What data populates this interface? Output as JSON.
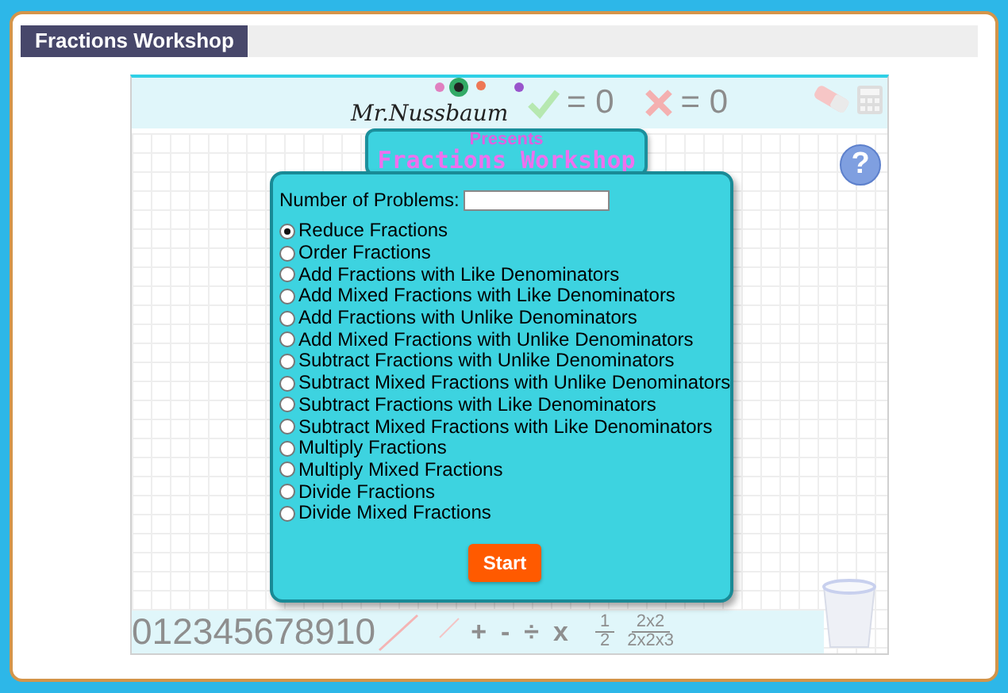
{
  "header": {
    "title": "Fractions Workshop"
  },
  "scoreboard": [
    {
      "kind": "correct",
      "text": "= 0"
    },
    {
      "kind": "wrong",
      "text": "= 0"
    }
  ],
  "logo": {
    "signature": "Mr.Nussbaum",
    "presents": "Presents",
    "title": "Fractions Workshop"
  },
  "help": {
    "text": "?"
  },
  "form": {
    "label": "Number of Problems:",
    "options": [
      {
        "label": "Reduce Fractions",
        "selected": true
      },
      {
        "label": "Order Fractions",
        "selected": false
      },
      {
        "label": "Add Fractions with Like Denominators",
        "selected": false
      },
      {
        "label": "Add Mixed Fractions with Like Denominators",
        "selected": false
      },
      {
        "label": "Add Fractions with Unlike Denominators",
        "selected": false
      },
      {
        "label": "Add Mixed Fractions with Unlike Denominators",
        "selected": false
      },
      {
        "label": "Subtract Fractions with Unlike Denominators",
        "selected": false
      },
      {
        "label": "Subtract Mixed Fractions with Unlike Denominators",
        "selected": false
      },
      {
        "label": "Subtract Fractions with Like Denominators",
        "selected": false
      },
      {
        "label": "Subtract Mixed Fractions with Like Denominators",
        "selected": false
      },
      {
        "label": "Multiply Fractions",
        "selected": false
      },
      {
        "label": "Multiply Mixed Fractions",
        "selected": false
      },
      {
        "label": "Divide Fractions",
        "selected": false
      },
      {
        "label": "Divide Mixed Fractions",
        "selected": false
      }
    ],
    "button": "Start"
  },
  "toolbar": {
    "digits": [
      "0",
      "1",
      "2",
      "3",
      "4",
      "5",
      "6",
      "7",
      "8",
      "9",
      "10"
    ],
    "operators": [
      "+",
      "-",
      "÷",
      "x"
    ],
    "fractions": [
      {
        "numerator": "1",
        "denominator": "2"
      },
      {
        "numerator": "2x2",
        "denominator": "2x2x3"
      }
    ]
  }
}
